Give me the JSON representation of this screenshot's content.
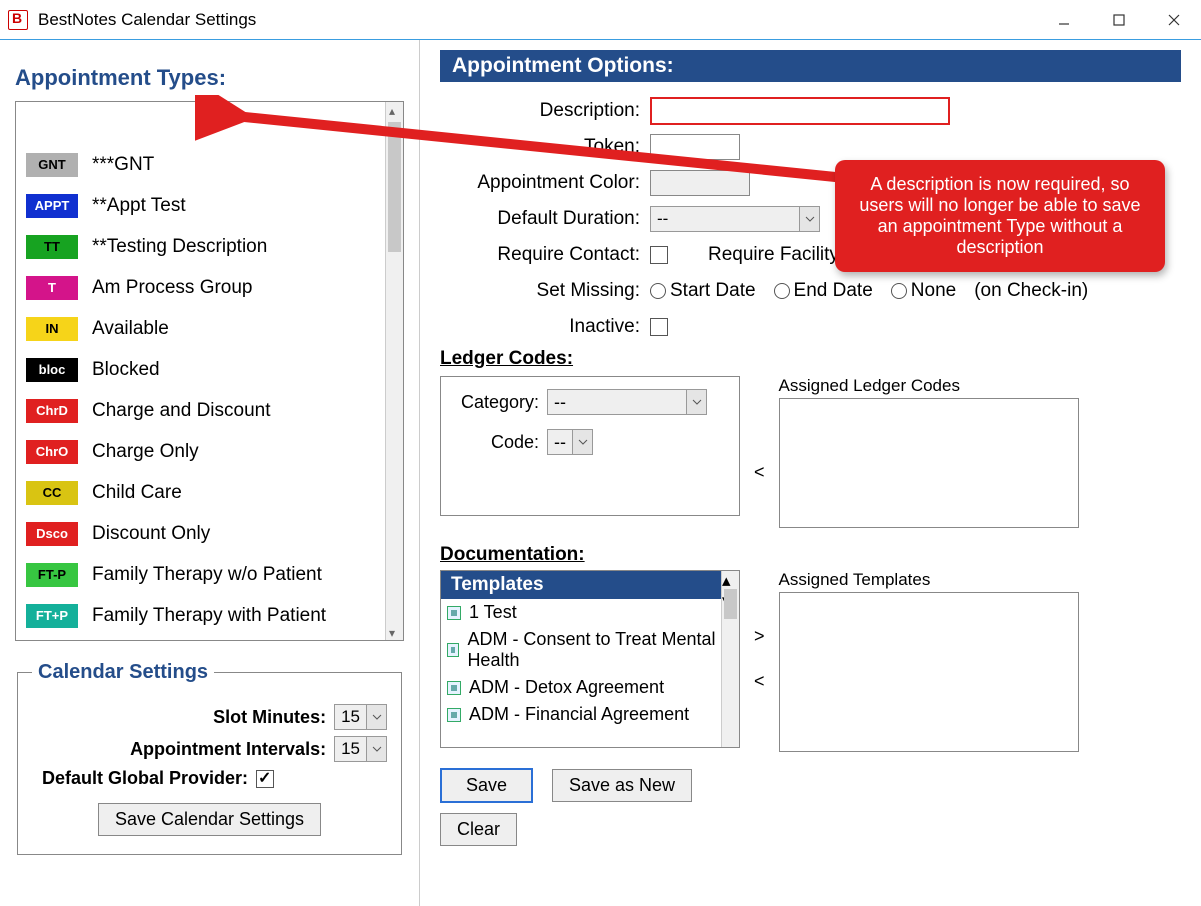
{
  "window": {
    "title": "BestNotes Calendar Settings"
  },
  "left": {
    "heading": "Appointment Types:",
    "types": [
      {
        "tag": "GNT",
        "bg": "#b0b0b0",
        "fg": "#000",
        "label": "***GNT"
      },
      {
        "tag": "APPT",
        "bg": "#1030d0",
        "fg": "#fff",
        "label": "**Appt Test"
      },
      {
        "tag": "TT",
        "bg": "#17a321",
        "fg": "#000",
        "label": "**Testing Description"
      },
      {
        "tag": "T",
        "bg": "#d4148a",
        "fg": "#fff",
        "label": "Am Process Group"
      },
      {
        "tag": "IN",
        "bg": "#f6d419",
        "fg": "#000",
        "label": "Available"
      },
      {
        "tag": "bloc",
        "bg": "#000000",
        "fg": "#fff",
        "label": "Blocked"
      },
      {
        "tag": "ChrD",
        "bg": "#e02020",
        "fg": "#fff",
        "label": "Charge and Discount"
      },
      {
        "tag": "ChrO",
        "bg": "#e02020",
        "fg": "#fff",
        "label": "Charge Only"
      },
      {
        "tag": "CC",
        "bg": "#d9c412",
        "fg": "#000",
        "label": "Child Care"
      },
      {
        "tag": "Dsco",
        "bg": "#e02020",
        "fg": "#fff",
        "label": "Discount Only"
      },
      {
        "tag": "FT-P",
        "bg": "#37c641",
        "fg": "#000",
        "label": "Family Therapy w/o Patient"
      },
      {
        "tag": "FT+P",
        "bg": "#14b09a",
        "fg": "#fff",
        "label": "Family Therapy with Patient"
      }
    ]
  },
  "calendar_settings": {
    "legend": "Calendar Settings",
    "slot_label": "Slot Minutes:",
    "slot_value": "15",
    "interval_label": "Appointment Intervals:",
    "interval_value": "15",
    "provider_label": "Default Global Provider:",
    "save_button": "Save Calendar Settings"
  },
  "options": {
    "header": "Appointment Options:",
    "desc_label": "Description:",
    "token_label": "Token:",
    "color_label": "Appointment Color:",
    "duration_label": "Default Duration:",
    "duration_value": "--",
    "require_contact_label": "Require Contact:",
    "require_facility_label": "Require Facility:",
    "set_missing_label": "Set Missing:",
    "radio_start": "Start Date",
    "radio_end": "End Date",
    "radio_none": "None",
    "checkin_suffix": "(on Check-in)",
    "inactive_label": "Inactive:"
  },
  "ledger": {
    "heading": "Ledger Codes:",
    "category_label": "Category:",
    "category_value": "--",
    "code_label": "Code:",
    "code_value": "--",
    "assigned_label": "Assigned Ledger Codes"
  },
  "documentation": {
    "heading": "Documentation:",
    "templates_header": "Templates",
    "assigned_label": "Assigned Templates",
    "items": [
      "1 Test",
      "ADM - Consent to Treat Mental Health",
      "ADM - Detox Agreement",
      "ADM - Financial Agreement"
    ]
  },
  "buttons": {
    "save": "Save",
    "save_as_new": "Save as New",
    "clear": "Clear"
  },
  "annotation": {
    "text": "A description is now required, so users will no longer be able to save an appointment Type without a description"
  }
}
